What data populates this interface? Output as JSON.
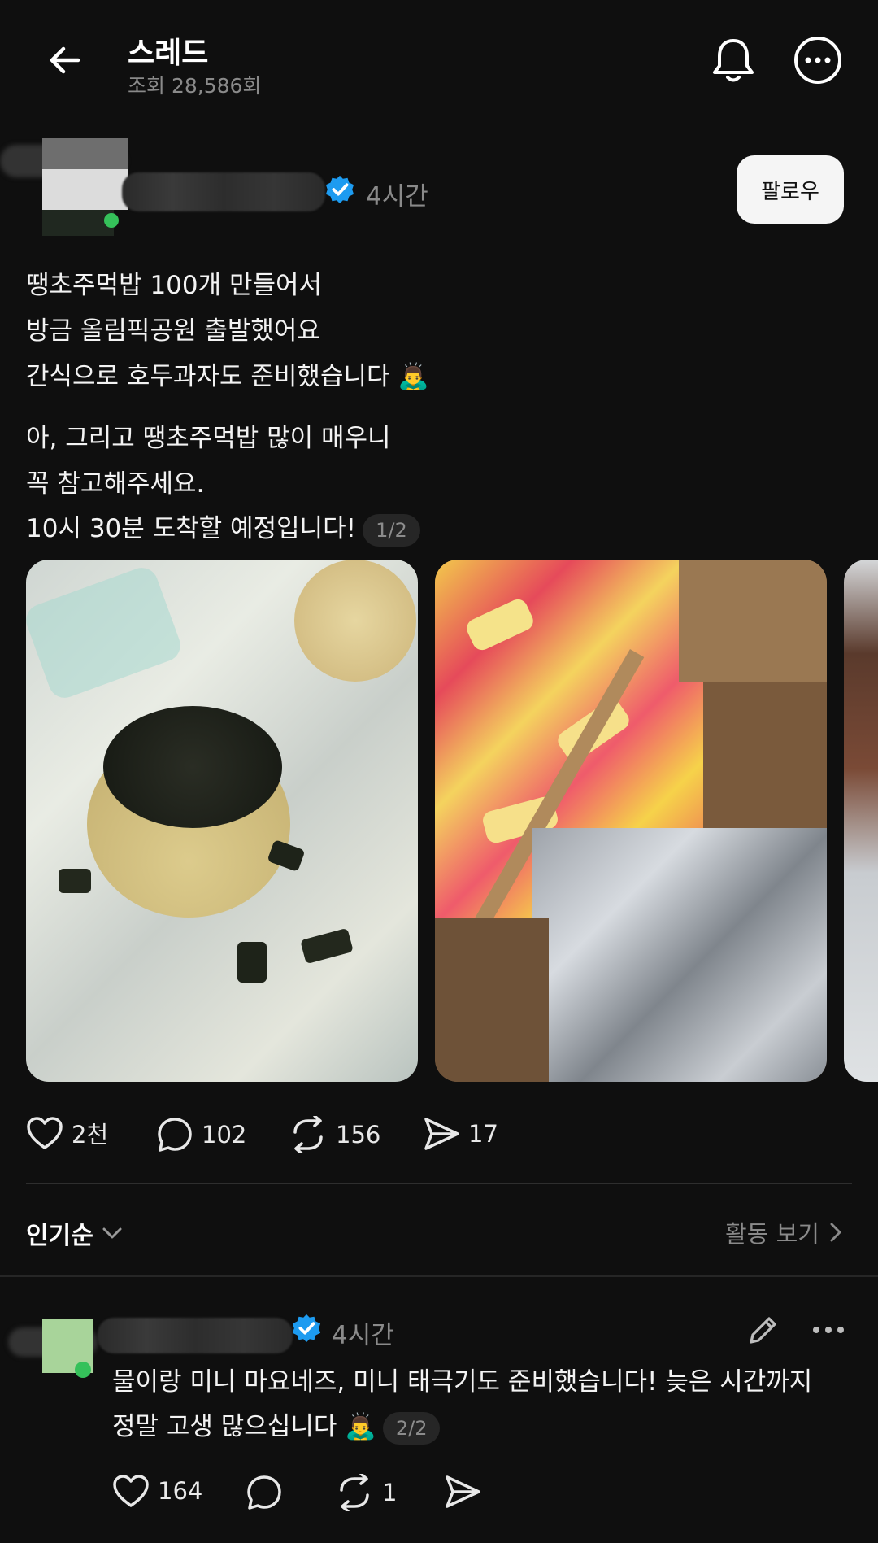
{
  "header": {
    "title": "스레드",
    "views": "조회 28,586회",
    "back_icon": "arrow-left-icon",
    "bell_icon": "bell-icon",
    "more_icon": "more-circle-icon"
  },
  "post": {
    "time": "4시간",
    "follow_label": "팔로우",
    "lines": [
      "땡초주먹밥 100개 만들어서",
      "방금 올림픽공원 출발했어요",
      "간식으로 호두과자도 준비했습니다 🙇‍♂️",
      "아, 그리고 땡초주먹밥 많이 매우니",
      "꼭 참고해주세요.",
      "10시 30분 도착할 예정입니다!"
    ],
    "page_indicator": "1/2",
    "actions": {
      "likes": "2천",
      "comments": "102",
      "reposts": "156",
      "shares": "17"
    }
  },
  "sort": {
    "label": "인기순",
    "activity": "활동 보기"
  },
  "reply": {
    "time": "4시간",
    "lines": [
      "물이랑 미니 마요네즈, 미니 태극기도 준비했습니다! 늦은 시간까지",
      "정말 고생 많으십니다 🙇‍♂️"
    ],
    "page_indicator": "2/2",
    "actions": {
      "likes": "164",
      "comments": "",
      "reposts": "1",
      "shares": ""
    }
  },
  "colors": {
    "background": "#0f0f0f",
    "verified": "#1d9bf0",
    "muted": "#8a8a8a"
  }
}
